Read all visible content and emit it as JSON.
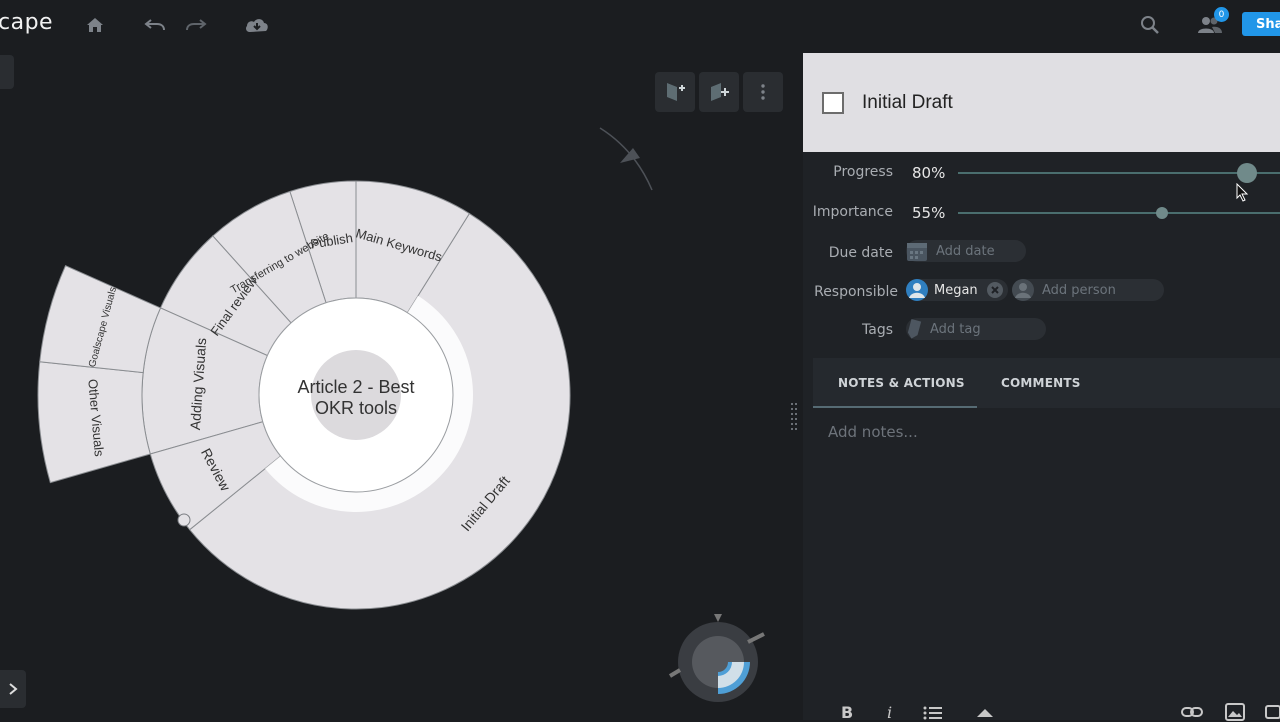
{
  "app": {
    "logo_text": "cape",
    "share_label": "Sha",
    "people_count": "0"
  },
  "toolbar": {
    "icons": [
      "home-icon",
      "undo-icon",
      "redo-icon",
      "cloud-download-icon",
      "search-icon",
      "people-icon"
    ]
  },
  "goalmap": {
    "center_title": "Article 2 - Best OKR tools",
    "segments": [
      {
        "label": "Initial Draft",
        "selected": true
      },
      {
        "label": "Main Keywords"
      },
      {
        "label": "Publish"
      },
      {
        "label": "Transferring to website"
      },
      {
        "label": "Final review"
      },
      {
        "label": "Adding Visuals"
      },
      {
        "label": "Review"
      }
    ],
    "sub_segments": [
      {
        "label": "Other Visuals"
      },
      {
        "label": "Goalscape Visuals"
      }
    ]
  },
  "panel": {
    "title": "Initial Draft",
    "progress_label": "Progress",
    "progress_value": "80%",
    "progress": 0.8,
    "importance_label": "Importance",
    "importance_value": "55%",
    "importance": 0.55,
    "due_label": "Due date",
    "due_placeholder": "Add date",
    "responsible_label": "Responsible",
    "person": "Megan",
    "add_person": "Add person",
    "tags_label": "Tags",
    "add_tag": "Add tag",
    "tabs": [
      "NOTES & ACTIONS",
      "COMMENTS"
    ],
    "notes_placeholder": "Add notes...",
    "format_tools": [
      "B",
      "i",
      "list-icon",
      "triangle-icon",
      "link-icon",
      "image-icon"
    ]
  },
  "colors": {
    "background": "#1b1d20",
    "segment_fill": "#e4e2e6",
    "accent": "#2196e8"
  }
}
